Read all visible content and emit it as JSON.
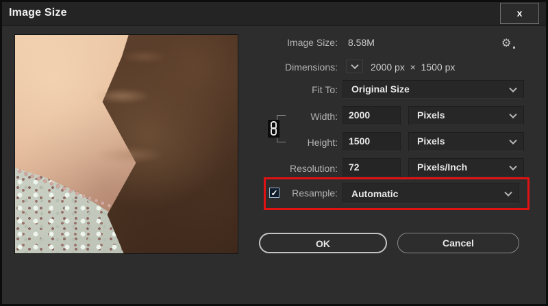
{
  "window": {
    "title": "Image Size",
    "close_label": "x"
  },
  "panel": {
    "image_size": {
      "label": "Image Size:",
      "value": "8.58M"
    },
    "dimensions": {
      "label": "Dimensions:",
      "value": "2000 px  ×  1500 px"
    },
    "fit_to": {
      "label": "Fit To:",
      "value": "Original Size"
    },
    "width": {
      "label": "Width:",
      "value": "2000",
      "unit": "Pixels"
    },
    "height": {
      "label": "Height:",
      "value": "1500",
      "unit": "Pixels"
    },
    "resolution": {
      "label": "Resolution:",
      "value": "72",
      "unit": "Pixels/Inch"
    },
    "resample": {
      "label": "Resample:",
      "value": "Automatic",
      "checked": true
    }
  },
  "buttons": {
    "ok": "OK",
    "cancel": "Cancel"
  },
  "icons": {
    "gear": "⚙",
    "check": "✓"
  },
  "colors": {
    "highlight_red": "#e01212",
    "dialog_bg": "#2d2d2e",
    "titlebar_bg": "#242425"
  }
}
